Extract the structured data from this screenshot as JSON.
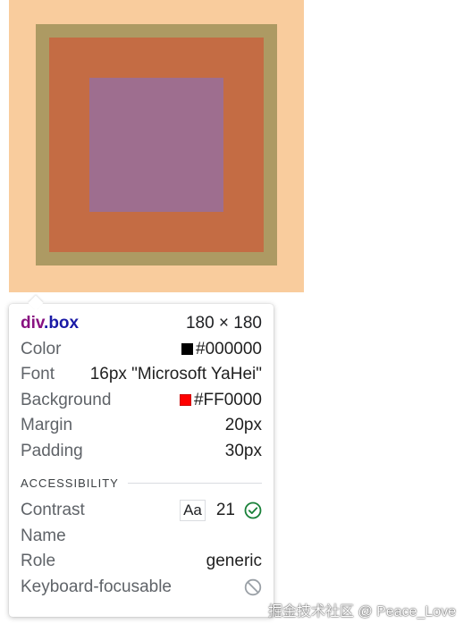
{
  "element": {
    "tag": "div",
    "class": ".box",
    "dimensions": "180 × 180"
  },
  "styles": {
    "color": {
      "label": "Color",
      "value": "#000000",
      "swatch": "#000000"
    },
    "font": {
      "label": "Font",
      "value": "16px \"Microsoft YaHei\""
    },
    "background": {
      "label": "Background",
      "value": "#FF0000",
      "swatch": "#FF0000"
    },
    "margin": {
      "label": "Margin",
      "value": "20px"
    },
    "padding": {
      "label": "Padding",
      "value": "30px"
    }
  },
  "accessibility": {
    "section_title": "ACCESSIBILITY",
    "contrast": {
      "label": "Contrast",
      "sample": "Aa",
      "ratio": "21",
      "status_icon": "check-circle-icon",
      "status_color": "#188038"
    },
    "name": {
      "label": "Name",
      "value": ""
    },
    "role": {
      "label": "Role",
      "value": "generic"
    },
    "keyboard": {
      "label": "Keyboard-focusable",
      "status_icon": "not-allowed-icon"
    }
  },
  "box_model_colors": {
    "margin": "#f9cc9d",
    "border": "#ad9a63",
    "padding": "#c46c44",
    "content": "#9e6e8f"
  },
  "watermark": "掘金技术社区 @ Peace_Love"
}
